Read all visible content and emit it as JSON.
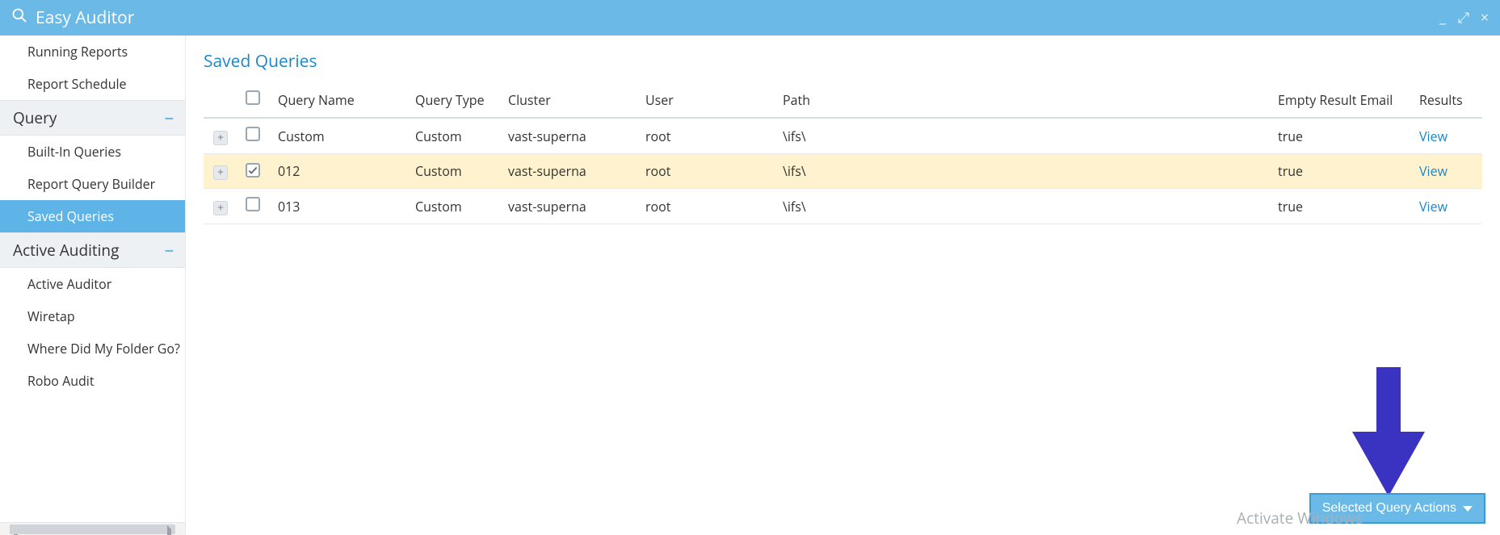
{
  "app": {
    "title": "Easy Auditor"
  },
  "window": {
    "minimize": "_",
    "restore": "⤢",
    "close": "×"
  },
  "sidebar": {
    "items_pre": [
      {
        "label": "Running Reports"
      },
      {
        "label": "Report Schedule"
      }
    ],
    "group_query": {
      "label": "Query",
      "toggle": "−"
    },
    "items_query": [
      {
        "label": "Built-In Queries"
      },
      {
        "label": "Report Query Builder"
      },
      {
        "label": "Saved Queries",
        "active": true
      }
    ],
    "group_active_auditing": {
      "label": "Active Auditing",
      "toggle": "−"
    },
    "items_aa": [
      {
        "label": "Active Auditor"
      },
      {
        "label": "Wiretap"
      },
      {
        "label": "Where Did My Folder Go?"
      },
      {
        "label": "Robo Audit"
      }
    ]
  },
  "main": {
    "title": "Saved Queries",
    "columns": {
      "expand": "",
      "check": "",
      "name": "Query Name",
      "type": "Query Type",
      "cluster": "Cluster",
      "user": "User",
      "path": "Path",
      "email": "Empty Result Email",
      "results": "Results"
    },
    "rows": [
      {
        "name": "Custom",
        "type": "Custom",
        "cluster": "vast-superna",
        "user": "root",
        "path": "\\ifs\\",
        "email": "true",
        "results": "View",
        "checked": false,
        "selected": false
      },
      {
        "name": "012",
        "type": "Custom",
        "cluster": "vast-superna",
        "user": "root",
        "path": "\\ifs\\",
        "email": "true",
        "results": "View",
        "checked": true,
        "selected": true
      },
      {
        "name": "013",
        "type": "Custom",
        "cluster": "vast-superna",
        "user": "root",
        "path": "\\ifs\\",
        "email": "true",
        "results": "View",
        "checked": false,
        "selected": false
      }
    ],
    "action_button": "Selected Query Actions",
    "watermark": "Activate Windows"
  },
  "icons": {
    "expand": "+"
  }
}
